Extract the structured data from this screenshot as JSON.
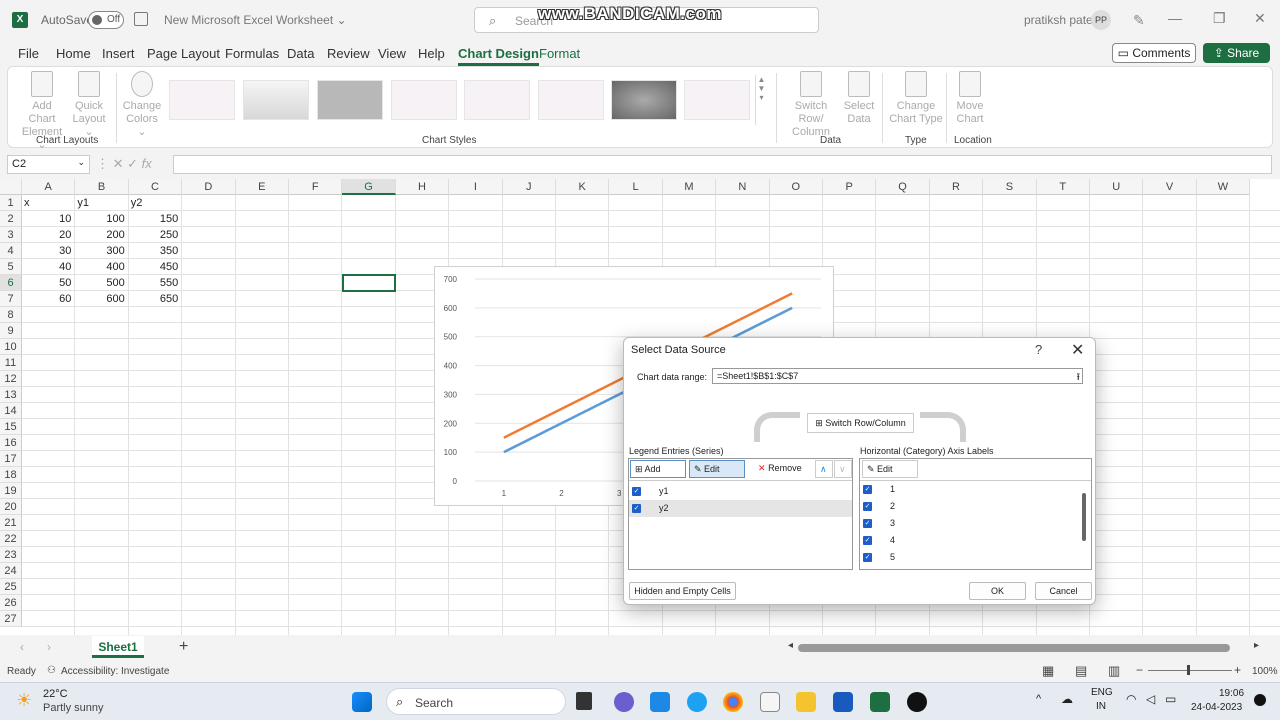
{
  "app": {
    "autosave_label": "AutoSave",
    "autosave_state": "Off",
    "doc_title": "New Microsoft Excel Worksheet",
    "search_placeholder": "Search",
    "watermark": "www.BANDICAM.com",
    "user_name": "pratiksh patel",
    "user_initials": "PP",
    "brand_color": "#1d6f42"
  },
  "ribbon": {
    "tabs": [
      "File",
      "Home",
      "Insert",
      "Page Layout",
      "Formulas",
      "Data",
      "Review",
      "View",
      "Help",
      "Chart Design",
      "Format"
    ],
    "active_tab": "Chart Design",
    "comments_label": "Comments",
    "share_label": "Share",
    "buttons": {
      "add_chart_element": [
        "Add Chart",
        "Element"
      ],
      "quick_layout": [
        "Quick",
        "Layout"
      ],
      "change_colors": [
        "Change",
        "Colors"
      ],
      "switch_row_col": [
        "Switch Row/",
        "Column"
      ],
      "select_data": [
        "Select",
        "Data"
      ],
      "change_chart_type": [
        "Change",
        "Chart Type"
      ],
      "move_chart": [
        "Move",
        "Chart"
      ]
    },
    "groups": {
      "chart_layouts": "Chart Layouts",
      "chart_styles": "Chart Styles",
      "data": "Data",
      "type": "Type",
      "location": "Location"
    }
  },
  "formula_bar": {
    "name_box": "C2",
    "fx": "fx",
    "formula": ""
  },
  "sheet": {
    "columns": [
      "A",
      "B",
      "C",
      "D",
      "E",
      "F",
      "G",
      "H",
      "I",
      "J",
      "K",
      "L",
      "M",
      "N",
      "O",
      "P",
      "Q",
      "R",
      "S",
      "T",
      "U",
      "V",
      "W"
    ],
    "selected_column": "G",
    "selected_row": "6",
    "rows": [
      "1",
      "2",
      "3",
      "4",
      "5",
      "6",
      "7",
      "8",
      "9",
      "10",
      "11",
      "12",
      "13",
      "14",
      "15",
      "16",
      "17",
      "18",
      "19",
      "20",
      "21",
      "22",
      "23",
      "24",
      "25",
      "26",
      "27"
    ],
    "headers": [
      "x",
      "y1",
      "y2"
    ],
    "data": [
      [
        "10",
        "100",
        "150"
      ],
      [
        "20",
        "200",
        "250"
      ],
      [
        "30",
        "300",
        "350"
      ],
      [
        "40",
        "400",
        "450"
      ],
      [
        "50",
        "500",
        "550"
      ],
      [
        "60",
        "600",
        "650"
      ]
    ],
    "sheet_tab": "Sheet1"
  },
  "chart_data": {
    "type": "line",
    "x": [
      "1",
      "2",
      "3",
      "4",
      "5",
      "6"
    ],
    "series": [
      {
        "name": "y1",
        "values": [
          100,
          200,
          300,
          400,
          500,
          600
        ],
        "color": "#5b9bd5"
      },
      {
        "name": "y2",
        "values": [
          150,
          250,
          350,
          450,
          550,
          650
        ],
        "color": "#ed7d31"
      }
    ],
    "y_ticks": [
      "0",
      "100",
      "200",
      "300",
      "400",
      "500",
      "600",
      "700"
    ],
    "x_ticks_visible": [
      "1",
      "2",
      "3"
    ],
    "ylim": [
      0,
      700
    ],
    "grid": true
  },
  "dialog": {
    "title": "Select Data Source",
    "help": "?",
    "close": "✕",
    "range_label": "Chart data range:",
    "range_value": "=Sheet1!$B$1:$C$7",
    "switch_label": "Switch Row/Column",
    "legend_label": "Legend Entries (Series)",
    "axis_label": "Horizontal (Category) Axis Labels",
    "add_label": "Add",
    "edit_label": "Edit",
    "remove_label": "Remove",
    "axis_edit_label": "Edit",
    "series": [
      "y1",
      "y2"
    ],
    "categories": [
      "1",
      "2",
      "3",
      "4",
      "5"
    ],
    "hidden_cells_label": "Hidden and Empty Cells",
    "ok_label": "OK",
    "cancel_label": "Cancel"
  },
  "status": {
    "ready": "Ready",
    "accessibility": "Accessibility: Investigate",
    "zoom": "100%"
  },
  "taskbar": {
    "temperature": "22°C",
    "weather": "Partly sunny",
    "search_placeholder": "Search",
    "lang1": "ENG",
    "lang2": "IN",
    "time": "19:06",
    "date": "24-04-2023"
  }
}
